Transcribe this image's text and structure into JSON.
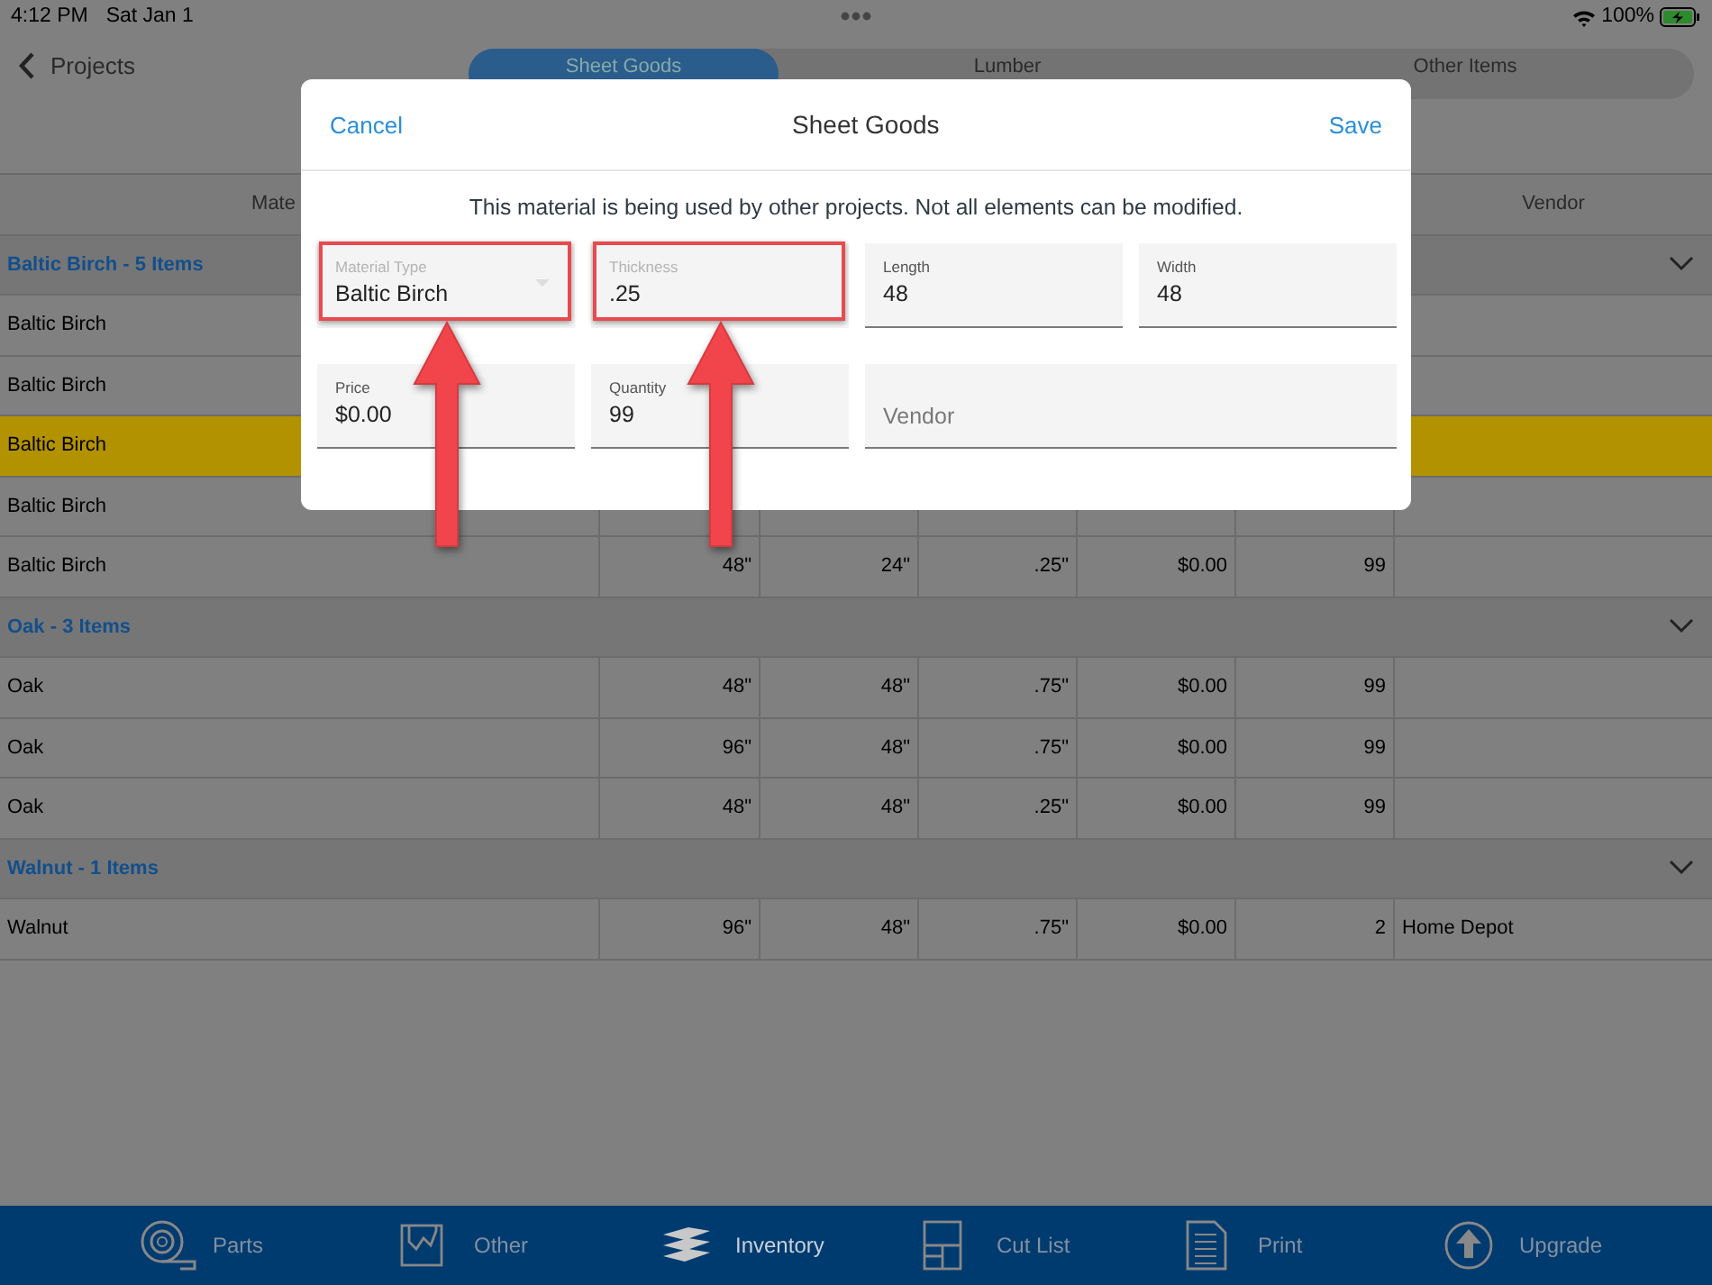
{
  "status_bar": {
    "time": "4:12 PM",
    "date": "Sat Jan 1",
    "battery": "100%"
  },
  "nav": {
    "back": "Projects"
  },
  "tabs": [
    {
      "label": "Sheet Goods",
      "selected": true
    },
    {
      "label": "Lumber",
      "selected": false
    },
    {
      "label": "Other Items",
      "selected": false
    }
  ],
  "table": {
    "columns": [
      {
        "label": "Mate"
      },
      {},
      {},
      {},
      {},
      {},
      {
        "label": "Vendor"
      }
    ],
    "groups": [
      {
        "title": "Baltic Birch - 5 Items",
        "expanded": true,
        "rows": [
          {
            "cells": [
              "Baltic Birch"
            ],
            "selected": false
          },
          {
            "cells": [
              "Baltic Birch"
            ],
            "selected": false
          },
          {
            "cells": [
              "Baltic Birch"
            ],
            "selected": true
          },
          {
            "cells": [
              "Baltic Birch"
            ],
            "selected": false
          },
          {
            "cells": [
              "Baltic Birch",
              "48\"",
              "24\"",
              ".25\"",
              "$0.00",
              "99"
            ],
            "selected": false
          }
        ]
      },
      {
        "title": "Oak - 3 Items",
        "expanded": true,
        "rows": [
          {
            "cells": [
              "Oak",
              "48\"",
              "48\"",
              ".75\"",
              "$0.00",
              "99"
            ],
            "selected": false
          },
          {
            "cells": [
              "Oak",
              "96\"",
              "48\"",
              ".75\"",
              "$0.00",
              "99"
            ],
            "selected": false
          },
          {
            "cells": [
              "Oak",
              "48\"",
              "48\"",
              ".25\"",
              "$0.00",
              "99"
            ],
            "selected": false
          }
        ]
      },
      {
        "title": "Walnut - 1 Items",
        "expanded": true,
        "rows": [
          {
            "cells": [
              "Walnut",
              "96\"",
              "48\"",
              ".75\"",
              "$0.00",
              "2",
              "Home Depot"
            ],
            "selected": false
          }
        ]
      }
    ]
  },
  "dialog": {
    "cancel": "Cancel",
    "title": "Sheet Goods",
    "save": "Save",
    "message": "This material is being used by other projects.  Not all elements can be modified.",
    "fields": [
      {
        "kind": "dropdown",
        "label": "Material Type",
        "value": "Baltic Birch",
        "disabled": true,
        "highlighted": true
      },
      {
        "kind": "text",
        "label": "Thickness",
        "value": ".25",
        "disabled": true,
        "highlighted": true
      },
      {
        "kind": "text",
        "label": "Length",
        "value": "48",
        "disabled": false,
        "highlighted": false
      },
      {
        "kind": "text",
        "label": "Width",
        "value": "48",
        "disabled": false,
        "highlighted": false
      },
      {
        "kind": "text",
        "label": "Price",
        "value": "$0.00",
        "disabled": false,
        "highlighted": false
      },
      {
        "kind": "text",
        "label": "Quantity",
        "value": "99",
        "disabled": false,
        "highlighted": false
      },
      {
        "kind": "wide",
        "placeholder": "Vendor",
        "disabled": false,
        "highlighted": false
      }
    ]
  },
  "bottom_tabs": [
    {
      "label": "Parts",
      "selected": false
    },
    {
      "label": "Other",
      "selected": false
    },
    {
      "label": "Inventory",
      "selected": true
    },
    {
      "label": "Cut List",
      "selected": false
    },
    {
      "label": "Print",
      "selected": false
    },
    {
      "label": "Upgrade",
      "selected": false
    }
  ]
}
